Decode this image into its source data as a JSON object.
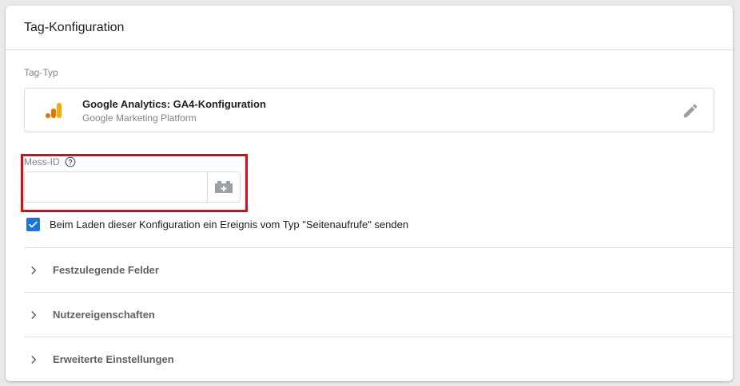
{
  "card": {
    "title": "Tag-Konfiguration"
  },
  "tag_type": {
    "label": "Tag-Typ",
    "name": "Google Analytics: GA4-Konfiguration",
    "platform": "Google Marketing Platform",
    "logo_icon": "google-analytics-logo",
    "edit_icon": "pencil-icon"
  },
  "measurement_id": {
    "label": "Mess-ID",
    "help_icon": "help-circle-icon",
    "value": "",
    "placeholder": "",
    "variable_icon": "add-variable-icon"
  },
  "send_pageview": {
    "checked": true,
    "label": "Beim Laden dieser Konfiguration ein Ereignis vom Typ \"Seitenaufrufe\" senden"
  },
  "sections": [
    {
      "label": "Festzulegende Felder"
    },
    {
      "label": "Nutzereigenschaften"
    },
    {
      "label": "Erweiterte Einstellungen"
    }
  ],
  "colors": {
    "accent": "#1a73e8",
    "highlight": "#e30613",
    "ga_orange": "#f9ab00",
    "ga_dark_orange": "#e37400"
  }
}
